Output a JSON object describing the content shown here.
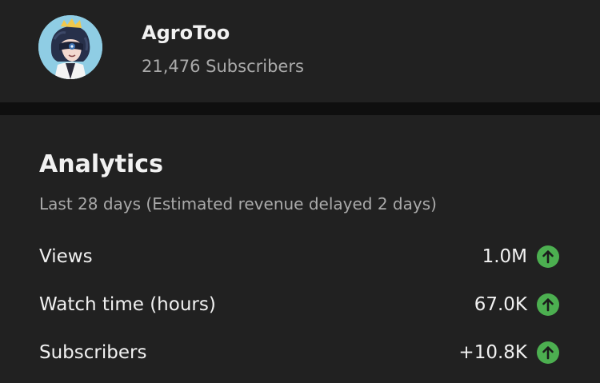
{
  "channel": {
    "name": "AgroToo",
    "subscribers": "21,476 Subscribers",
    "avatar_icon": "avatar-illustration"
  },
  "analytics": {
    "title": "Analytics",
    "subtitle": "Last 28 days (Estimated revenue delayed 2 days)",
    "metrics": [
      {
        "label": "Views",
        "value": "1.0M",
        "trend": "up",
        "trend_icon": "arrow-up-circle-icon"
      },
      {
        "label": "Watch time (hours)",
        "value": "67.0K",
        "trend": "up",
        "trend_icon": "arrow-up-circle-icon"
      },
      {
        "label": "Subscribers",
        "value": "+10.8K",
        "trend": "up",
        "trend_icon": "arrow-up-circle-icon"
      }
    ]
  },
  "colors": {
    "background": "#212121",
    "divider": "#0f0f0f",
    "primary_text": "#f1f1f1",
    "secondary_text": "#aaaaaa",
    "trend_up": "#4caf50",
    "avatar_bg": "#8fcde4"
  }
}
